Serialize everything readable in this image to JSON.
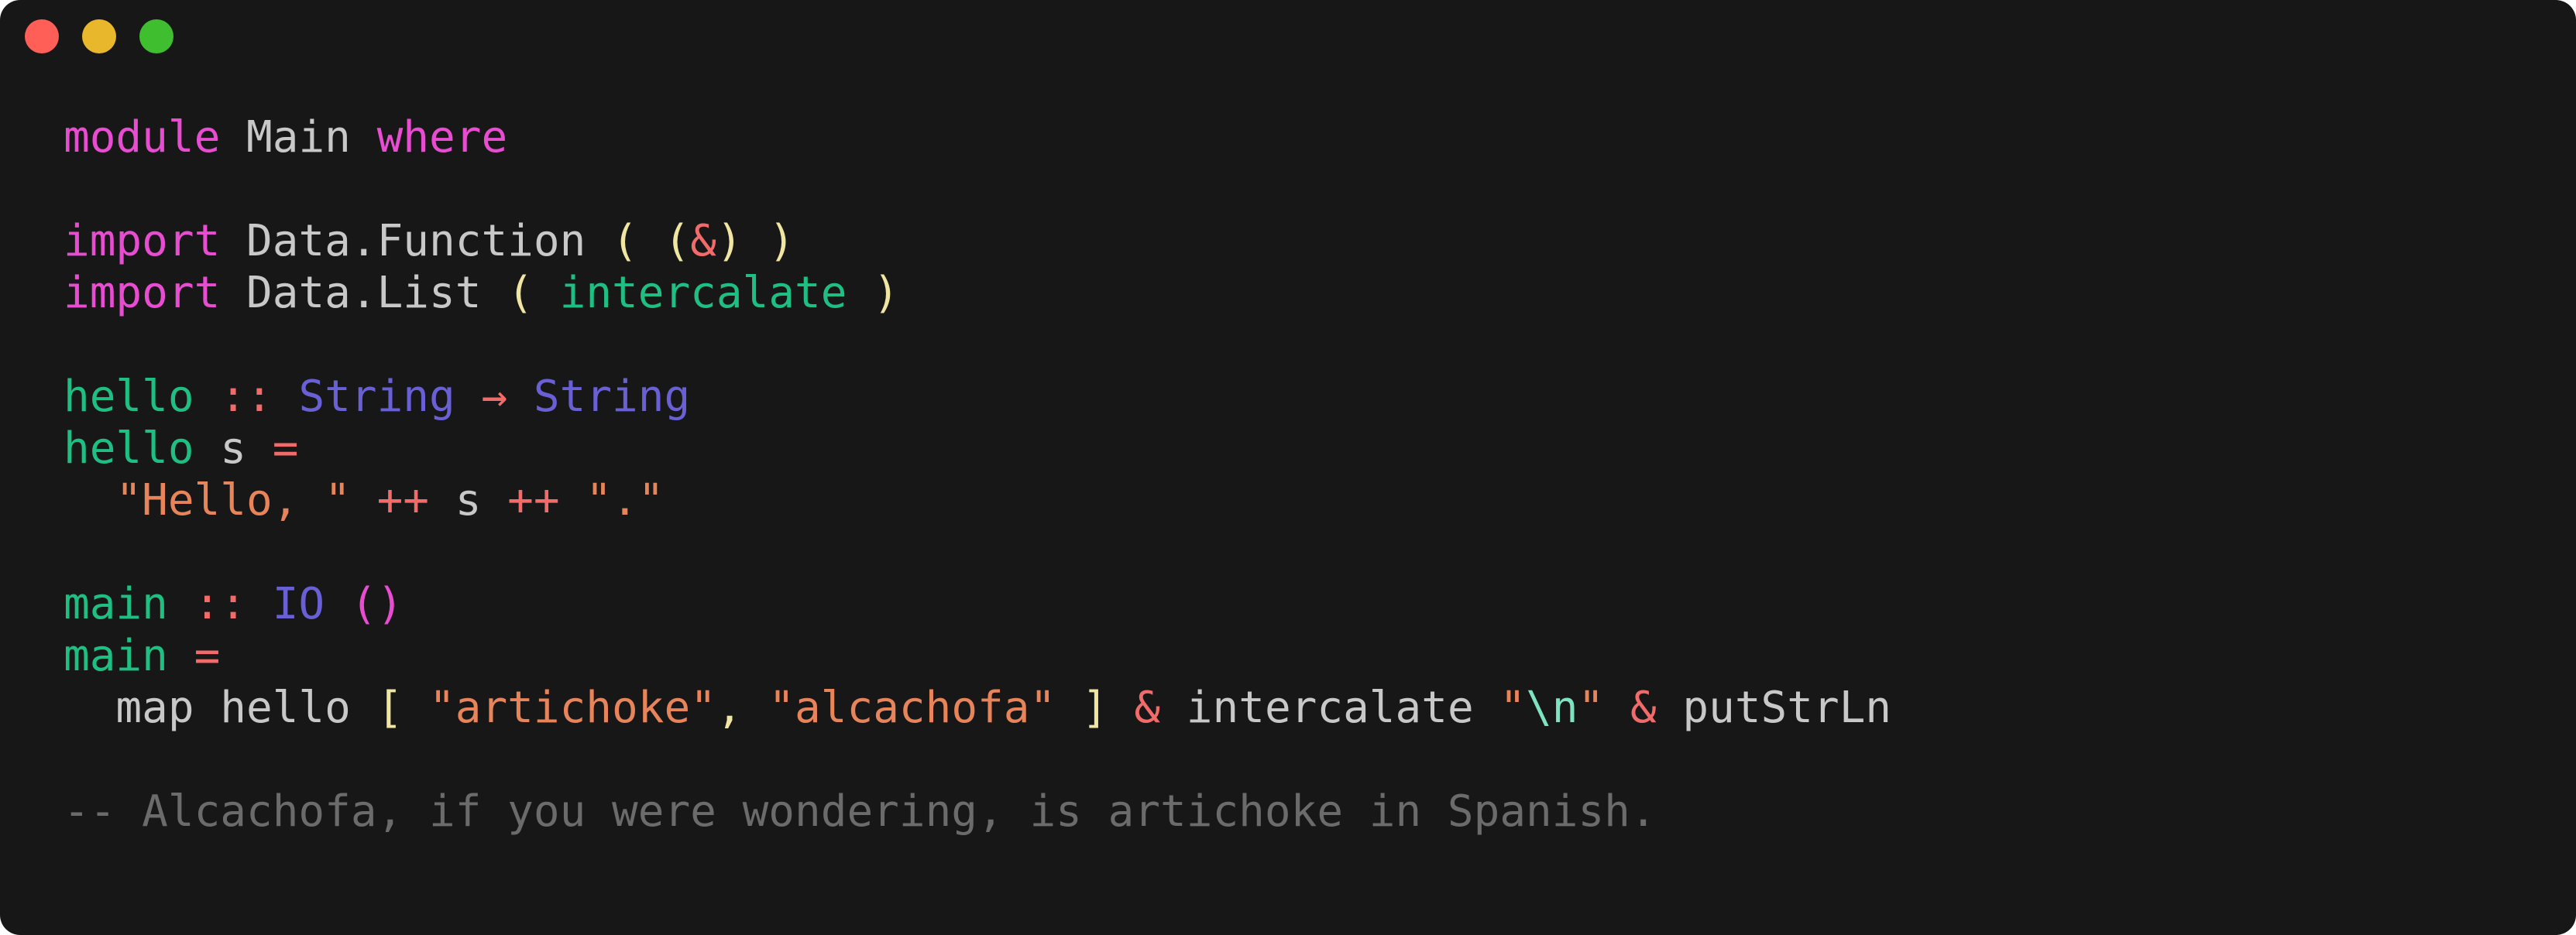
{
  "window": {
    "controls": [
      {
        "name": "close-button",
        "icon": "red-circle-icon",
        "color": "#ff5f57"
      },
      {
        "name": "minimize-button",
        "icon": "yellow-circle-icon",
        "color": "#e8b72b"
      },
      {
        "name": "maximize-button",
        "icon": "green-circle-icon",
        "color": "#3fbf2f"
      }
    ]
  },
  "colors": {
    "background": "#171717",
    "keyword": "#e84dd1",
    "identifier": "#c8c8c8",
    "function": "#1fbf83",
    "type": "#6960d6",
    "operator": "#f26b6b",
    "string": "#e8845a",
    "paren": "#f0e6a2",
    "escape": "#7ee3c0",
    "comment": "#6b6b6b"
  },
  "code": {
    "lines": [
      [
        {
          "t": "module",
          "c": "#e84dd1"
        },
        {
          "t": " Main ",
          "c": "#c8c8c8"
        },
        {
          "t": "where",
          "c": "#e84dd1"
        }
      ],
      [],
      [
        {
          "t": "import",
          "c": "#e84dd1"
        },
        {
          "t": " Data.Function ",
          "c": "#c8c8c8"
        },
        {
          "t": "( (",
          "c": "#f0e6a2"
        },
        {
          "t": "&",
          "c": "#f26b6b"
        },
        {
          "t": ") )",
          "c": "#f0e6a2"
        }
      ],
      [
        {
          "t": "import",
          "c": "#e84dd1"
        },
        {
          "t": " Data.List ",
          "c": "#c8c8c8"
        },
        {
          "t": "( ",
          "c": "#f0e6a2"
        },
        {
          "t": "intercalate",
          "c": "#1fbf83"
        },
        {
          "t": " )",
          "c": "#f0e6a2"
        }
      ],
      [],
      [
        {
          "t": "hello",
          "c": "#1fbf83"
        },
        {
          "t": " :: ",
          "c": "#f26b6b"
        },
        {
          "t": "String",
          "c": "#6960d6"
        },
        {
          "t": " → ",
          "c": "#f26b6b"
        },
        {
          "t": "String",
          "c": "#6960d6"
        }
      ],
      [
        {
          "t": "hello",
          "c": "#1fbf83"
        },
        {
          "t": " s ",
          "c": "#c8c8c8"
        },
        {
          "t": "=",
          "c": "#f26b6b"
        }
      ],
      [
        {
          "t": "  ",
          "c": "#c8c8c8"
        },
        {
          "t": "\"Hello, \"",
          "c": "#e8845a"
        },
        {
          "t": " ++ ",
          "c": "#f26b6b"
        },
        {
          "t": "s",
          "c": "#c8c8c8"
        },
        {
          "t": " ++ ",
          "c": "#f26b6b"
        },
        {
          "t": "\".\"",
          "c": "#e8845a"
        }
      ],
      [],
      [
        {
          "t": "main",
          "c": "#1fbf83"
        },
        {
          "t": " :: ",
          "c": "#f26b6b"
        },
        {
          "t": "IO",
          "c": "#6960d6"
        },
        {
          "t": " ()",
          "c": "#e84dd1"
        }
      ],
      [
        {
          "t": "main",
          "c": "#1fbf83"
        },
        {
          "t": " =",
          "c": "#f26b6b"
        }
      ],
      [
        {
          "t": "  map hello ",
          "c": "#c8c8c8"
        },
        {
          "t": "[",
          "c": "#f0e6a2"
        },
        {
          "t": " ",
          "c": "#c8c8c8"
        },
        {
          "t": "\"artichoke\"",
          "c": "#e8845a"
        },
        {
          "t": ", ",
          "c": "#f0e6a2"
        },
        {
          "t": "\"alcachofa\"",
          "c": "#e8845a"
        },
        {
          "t": " ",
          "c": "#c8c8c8"
        },
        {
          "t": "]",
          "c": "#f0e6a2"
        },
        {
          "t": " & ",
          "c": "#f26b6b"
        },
        {
          "t": "intercalate ",
          "c": "#c8c8c8"
        },
        {
          "t": "\"",
          "c": "#e8845a"
        },
        {
          "t": "\\n",
          "c": "#7ee3c0"
        },
        {
          "t": "\"",
          "c": "#e8845a"
        },
        {
          "t": " & ",
          "c": "#f26b6b"
        },
        {
          "t": "putStrLn",
          "c": "#c8c8c8"
        }
      ],
      [],
      [
        {
          "t": "-- Alcachofa, if you were wondering, is artichoke in Spanish.",
          "c": "#6b6b6b"
        }
      ]
    ]
  }
}
